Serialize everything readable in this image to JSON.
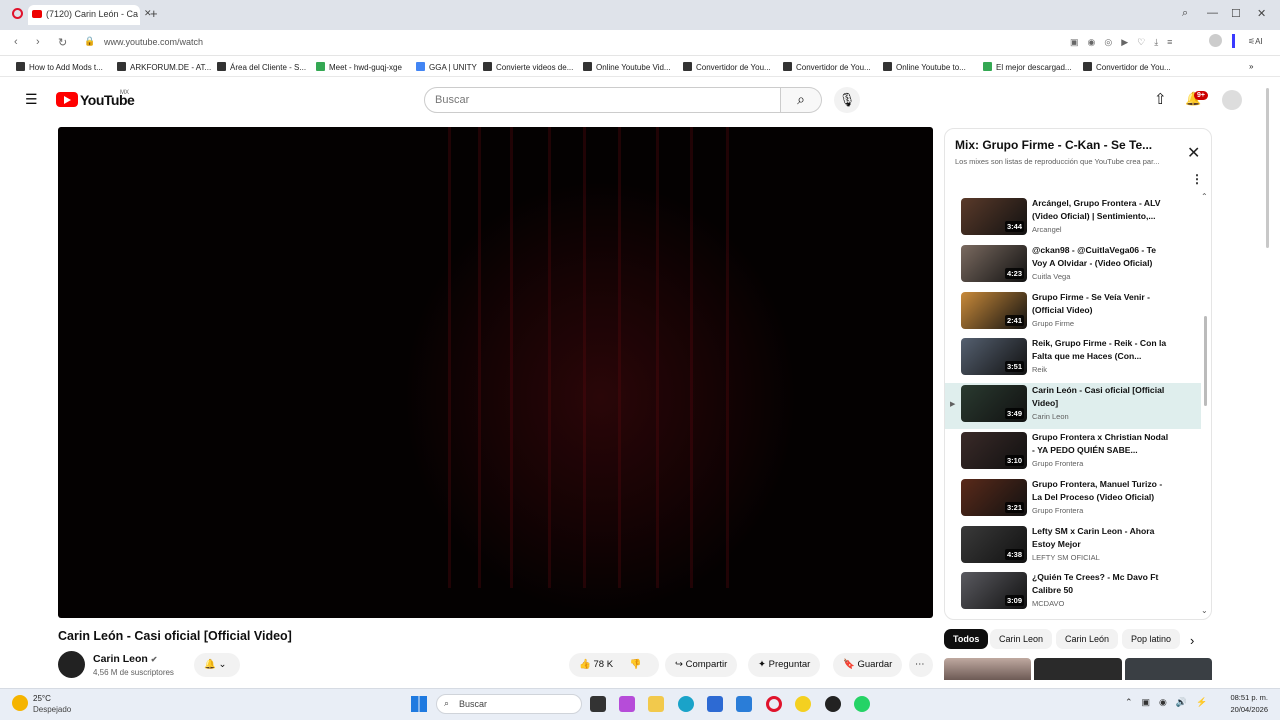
{
  "browser": {
    "tab_title": "(7120) Carin León - Ca",
    "url": "www.youtube.com/watch",
    "bookmarks": [
      "How to Add Mods t...",
      "ARKFORUM.DE - AT...",
      "Área del Cliente - S...",
      "Meet - hwd-guqj-xge",
      "GGA | UNITY",
      "Convierte videos de...",
      "Online Youtube Vid...",
      "Convertidor de You...",
      "Convertidor de You...",
      "Online Youtube to...",
      "El mejor descargad...",
      "Convertidor de You..."
    ]
  },
  "youtube": {
    "logo_text": "YouTube",
    "region": "MX",
    "search_placeholder": "Buscar",
    "notifications_badge": "9+"
  },
  "video": {
    "title": "Carin León - Casi oficial [Official Video]",
    "channel": "Carin Leon",
    "subscribers": "4,56 M de suscriptores",
    "likes": "78 K",
    "share_label": "Compartir",
    "ask_label": "Preguntar",
    "save_label": "Guardar"
  },
  "playlist": {
    "title": "Mix: Grupo Firme - C-Kan - Se Te...",
    "subtitle": "Los mixes son listas de reproducción que YouTube crea par...",
    "items": [
      {
        "title": "Arcángel, Grupo Frontera - ALV (Video Oficial) | Sentimiento,...",
        "author": "Arcangel",
        "duration": "3:44"
      },
      {
        "title": "@ckan98 - @CuitlaVega06 - Te Voy A Olvidar - (Video Oficial)",
        "author": "Cuitla Vega",
        "duration": "4:23"
      },
      {
        "title": "Grupo Firme - Se Veía Venir - (Official Video)",
        "author": "Grupo Firme",
        "duration": "2:41"
      },
      {
        "title": "Reik, Grupo Firme - Reik - Con la Falta que me Haces (Con...",
        "author": "Reik",
        "duration": "3:51"
      },
      {
        "title": "Carin León - Casi oficial [Official Video]",
        "author": "Carin Leon",
        "duration": "3:49",
        "active": true
      },
      {
        "title": "Grupo Frontera x Christian Nodal - YA PEDO QUIÉN SABE...",
        "author": "Grupo Frontera",
        "duration": "3:10"
      },
      {
        "title": "Grupo Frontera, Manuel Turizo - La Del Proceso (Video Oficial)",
        "author": "Grupo Frontera",
        "duration": "3:21"
      },
      {
        "title": "Lefty SM x Carin Leon - Ahora Estoy Mejor",
        "author": "LEFTY SM OFICIAL",
        "duration": "4:38"
      },
      {
        "title": "¿Quién Te Crees? - Mc Davo Ft Calibre 50",
        "author": "MCDAVO",
        "duration": "3:09"
      }
    ]
  },
  "chips": [
    "Todos",
    "Carin Leon",
    "Carin León",
    "Pop latino"
  ],
  "taskbar": {
    "weather_temp": "25°C",
    "weather_desc": "Despejado",
    "search_label": "Buscar",
    "time": "08:51 p. m.",
    "date": "20/04/2026"
  },
  "colors": {
    "youtube_red": "#ff0000",
    "active_row": "#dfeeed"
  }
}
